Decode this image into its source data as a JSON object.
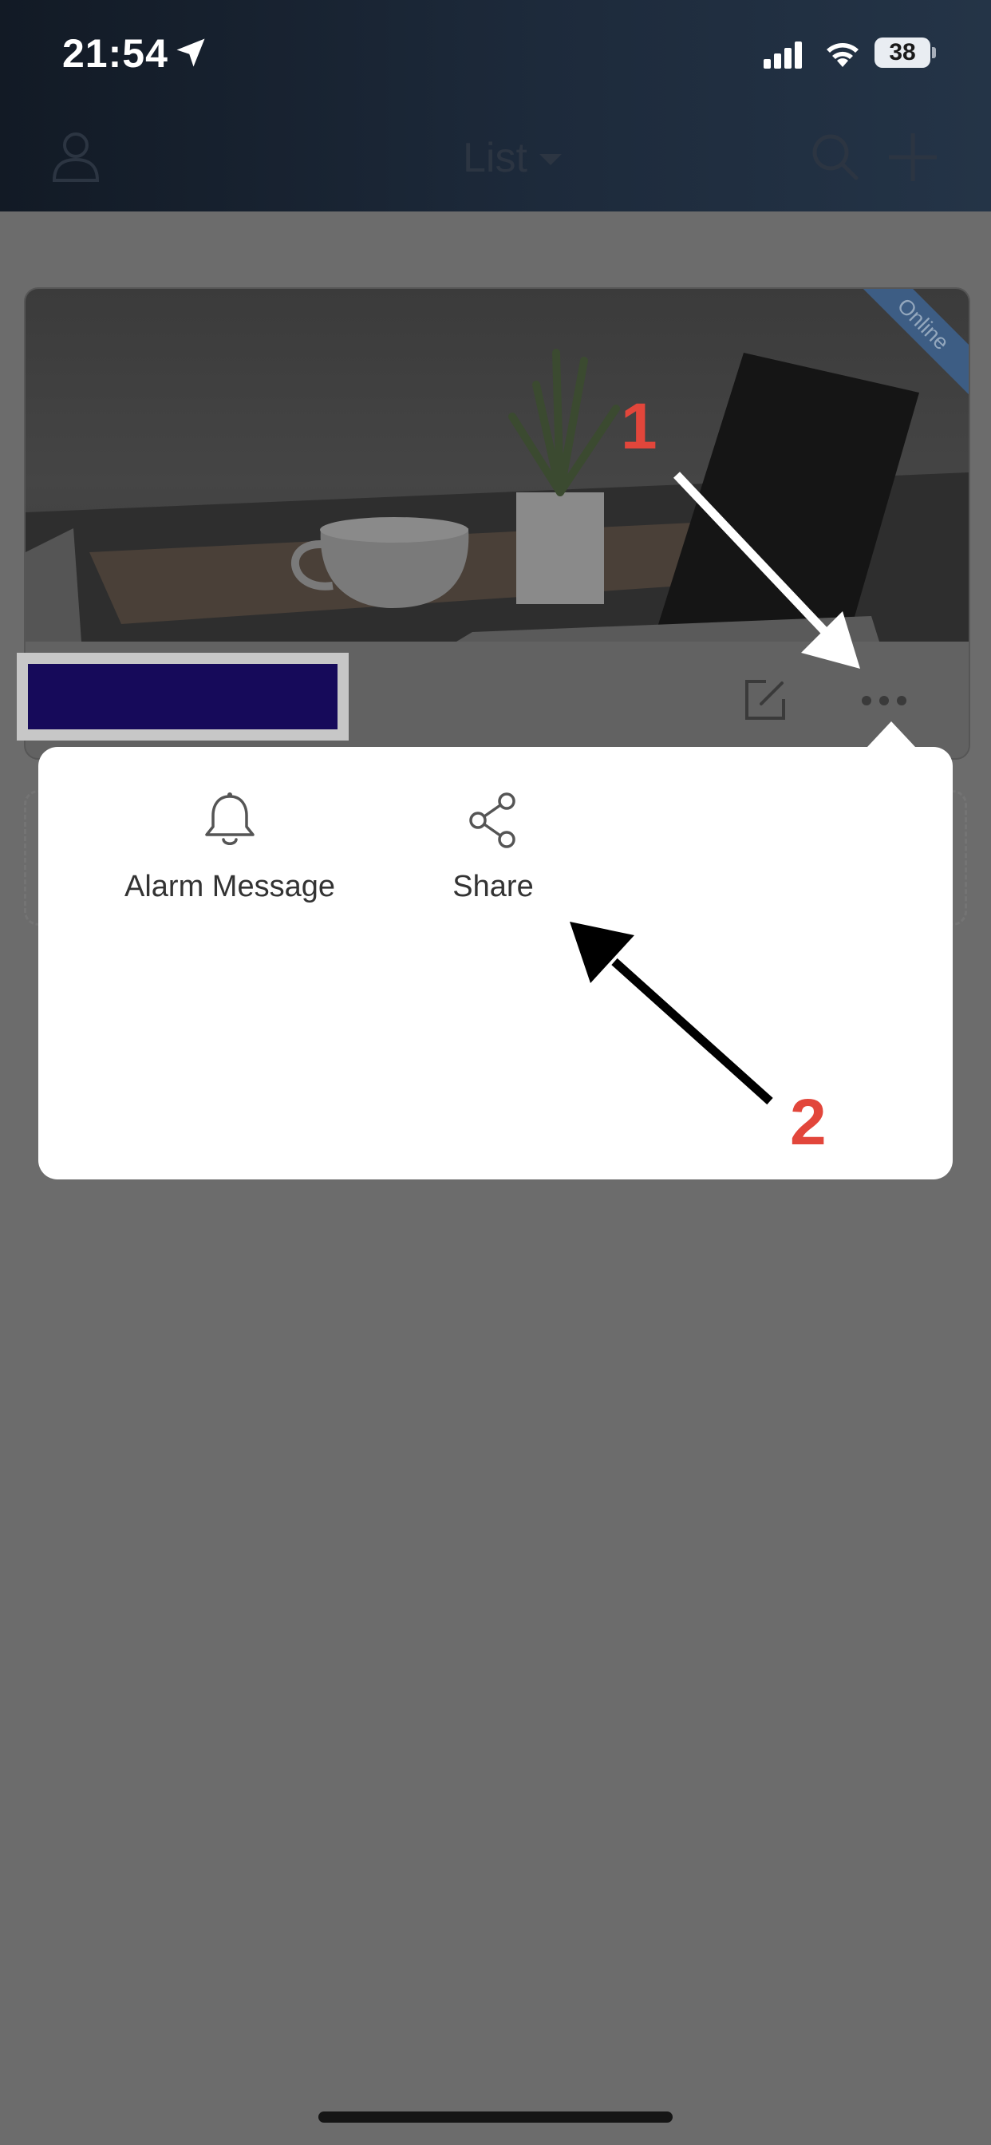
{
  "status_bar": {
    "time": "21:54",
    "battery_level": "38",
    "icons": [
      "location-arrow-icon",
      "cellular-signal-icon",
      "wifi-icon",
      "battery-icon"
    ]
  },
  "header": {
    "title": "List",
    "icons": [
      "user-icon",
      "caret-down-icon",
      "search-icon",
      "plus-icon"
    ]
  },
  "device_card": {
    "status_badge": "Online",
    "icons": [
      "edit-icon",
      "more-icon"
    ]
  },
  "popup_menu": {
    "items": [
      {
        "label": "Alarm Message",
        "icon": "bell-icon"
      },
      {
        "label": "Share",
        "icon": "share-icon"
      }
    ]
  },
  "annotations": {
    "step1": "1",
    "step2": "2"
  },
  "colors": {
    "annotation_number": "#e2463b",
    "online_badge": "#3d5d84",
    "redaction_fill": "#160a5a"
  }
}
